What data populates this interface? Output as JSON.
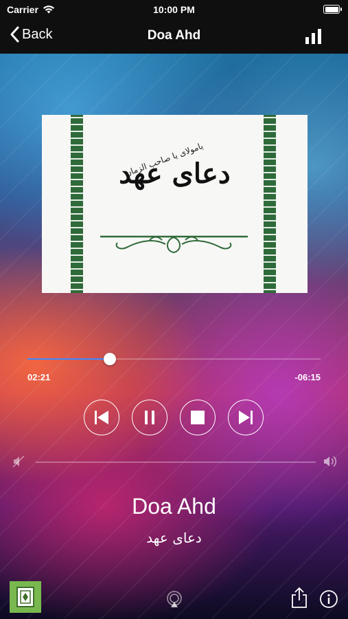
{
  "status_bar": {
    "carrier": "Carrier",
    "time": "10:00 PM"
  },
  "nav": {
    "back_label": "Back",
    "title": "Doa Ahd"
  },
  "artwork": {
    "main_text": "دعای عهد",
    "sub_text": "یامولای یا صاحب الزمان"
  },
  "player": {
    "elapsed": "02:21",
    "remaining": "-06:15",
    "progress_fraction": 0.28,
    "volume_fraction": 0.0
  },
  "track": {
    "title": "Doa Ahd",
    "subtitle": "دعای عهد"
  },
  "colors": {
    "accent": "#3b8bff",
    "book_icon_bg": "#79b84e",
    "artwork_green": "#2f6a3a"
  },
  "icons": {
    "back": "chevron-left-icon",
    "menu": "bar-chart-icon",
    "previous": "skip-previous-icon",
    "pause": "pause-icon",
    "stop": "stop-icon",
    "next": "skip-next-icon",
    "mute": "volume-mute-icon",
    "volume": "volume-up-icon",
    "book": "book-icon",
    "airplay": "airplay-icon",
    "share": "share-icon",
    "info": "info-icon"
  }
}
